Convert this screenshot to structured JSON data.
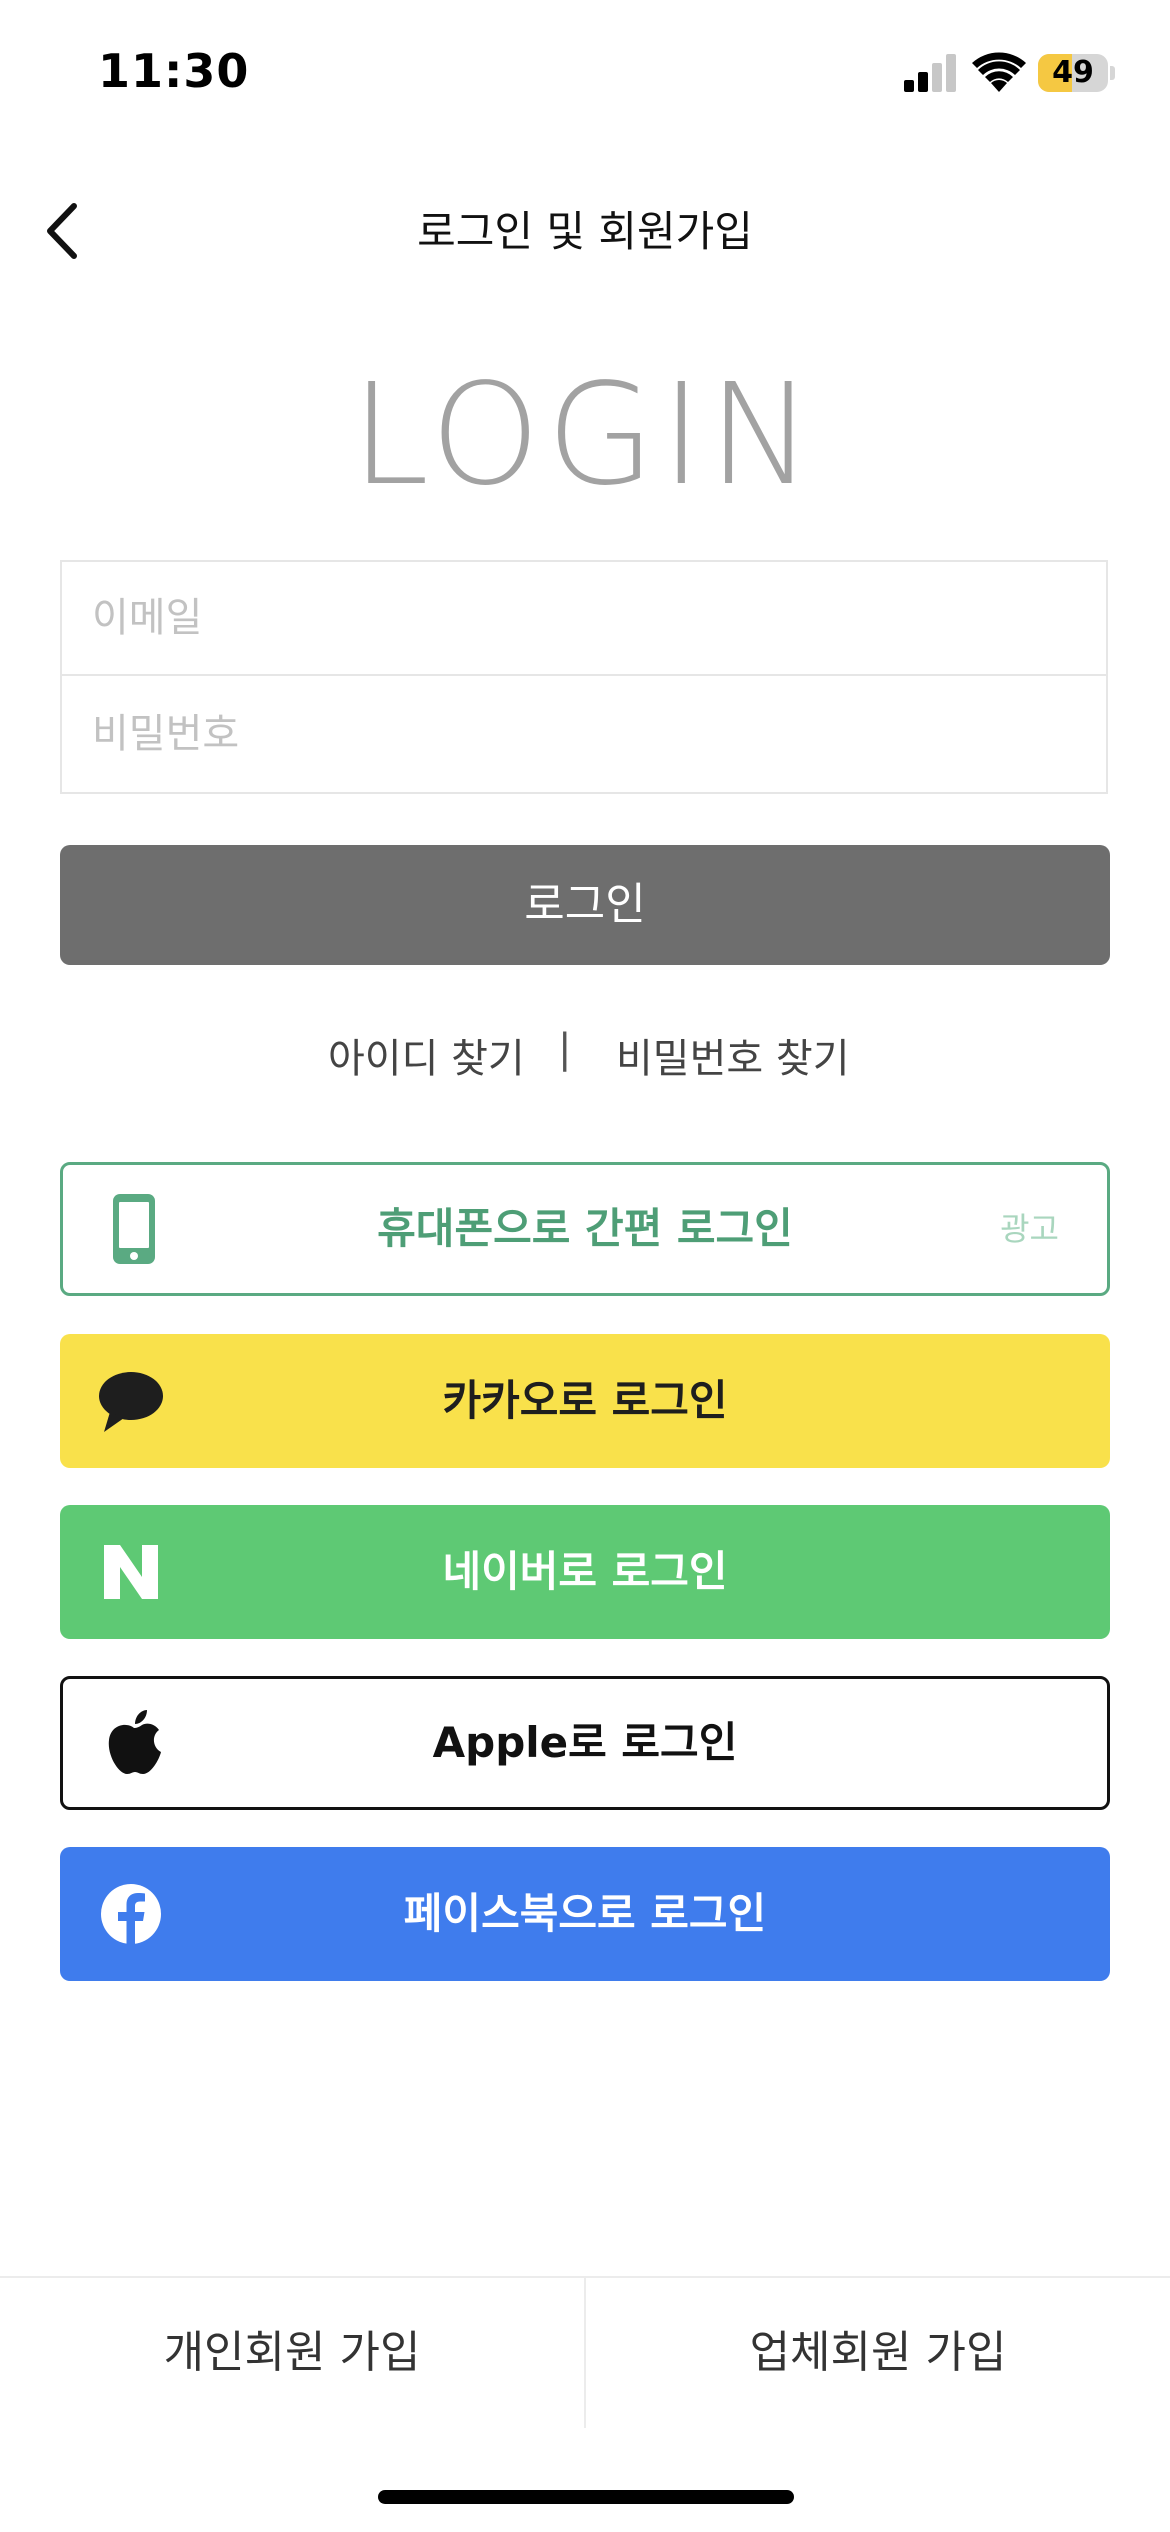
{
  "status_bar": {
    "time": "11:30",
    "battery": "49"
  },
  "header": {
    "title": "로그인 및 회원가입",
    "back_icon": "chevron-left-icon"
  },
  "login_heading": "LOGIN",
  "form": {
    "email_placeholder": "이메일",
    "password_placeholder": "비밀번호",
    "email_value": "",
    "password_value": "",
    "login_button": "로그인"
  },
  "find_links": {
    "find_id": "아이디 찾기",
    "separator": "|",
    "find_password": "비밀번호 찾기"
  },
  "social_logins": {
    "phone": {
      "label": "휴대폰으로 간편 로그인",
      "ad": "광고",
      "icon": "phone-icon",
      "color": "#4e9e76"
    },
    "kakao": {
      "label": "카카오로 로그인",
      "icon": "speech-bubble-icon",
      "color": "#f9e14b"
    },
    "naver": {
      "label": "네이버로 로그인",
      "icon": "naver-n-icon",
      "color": "#5ec974"
    },
    "apple": {
      "label": "Apple로 로그인",
      "icon": "apple-logo-icon",
      "color": "#111111"
    },
    "facebook": {
      "label": "페이스북으로 로그인",
      "icon": "facebook-logo-icon",
      "color": "#3f7ced"
    }
  },
  "bottom_tabs": {
    "personal": "개인회원 가입",
    "business": "업체회원 가입"
  }
}
